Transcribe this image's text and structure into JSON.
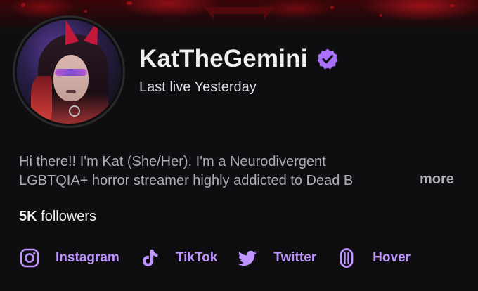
{
  "channel": {
    "name": "KatTheGemini",
    "status": "Last live Yesterday",
    "verified_icon": "verified-badge-icon",
    "accent_color": "#a970ff"
  },
  "bio": {
    "line1": "Hi there!! I'm Kat (She/Her). I'm a Neurodivergent",
    "line2": "LGBTQIA+ horror streamer highly addicted to Dead B",
    "more_label": "more"
  },
  "followers": {
    "count": "5K",
    "label": "followers"
  },
  "socials": [
    {
      "label": "Instagram",
      "icon": "instagram-icon"
    },
    {
      "label": "TikTok",
      "icon": "tiktok-icon"
    },
    {
      "label": "Twitter",
      "icon": "twitter-icon"
    },
    {
      "label": "Hover",
      "icon": "hover-icon"
    }
  ]
}
